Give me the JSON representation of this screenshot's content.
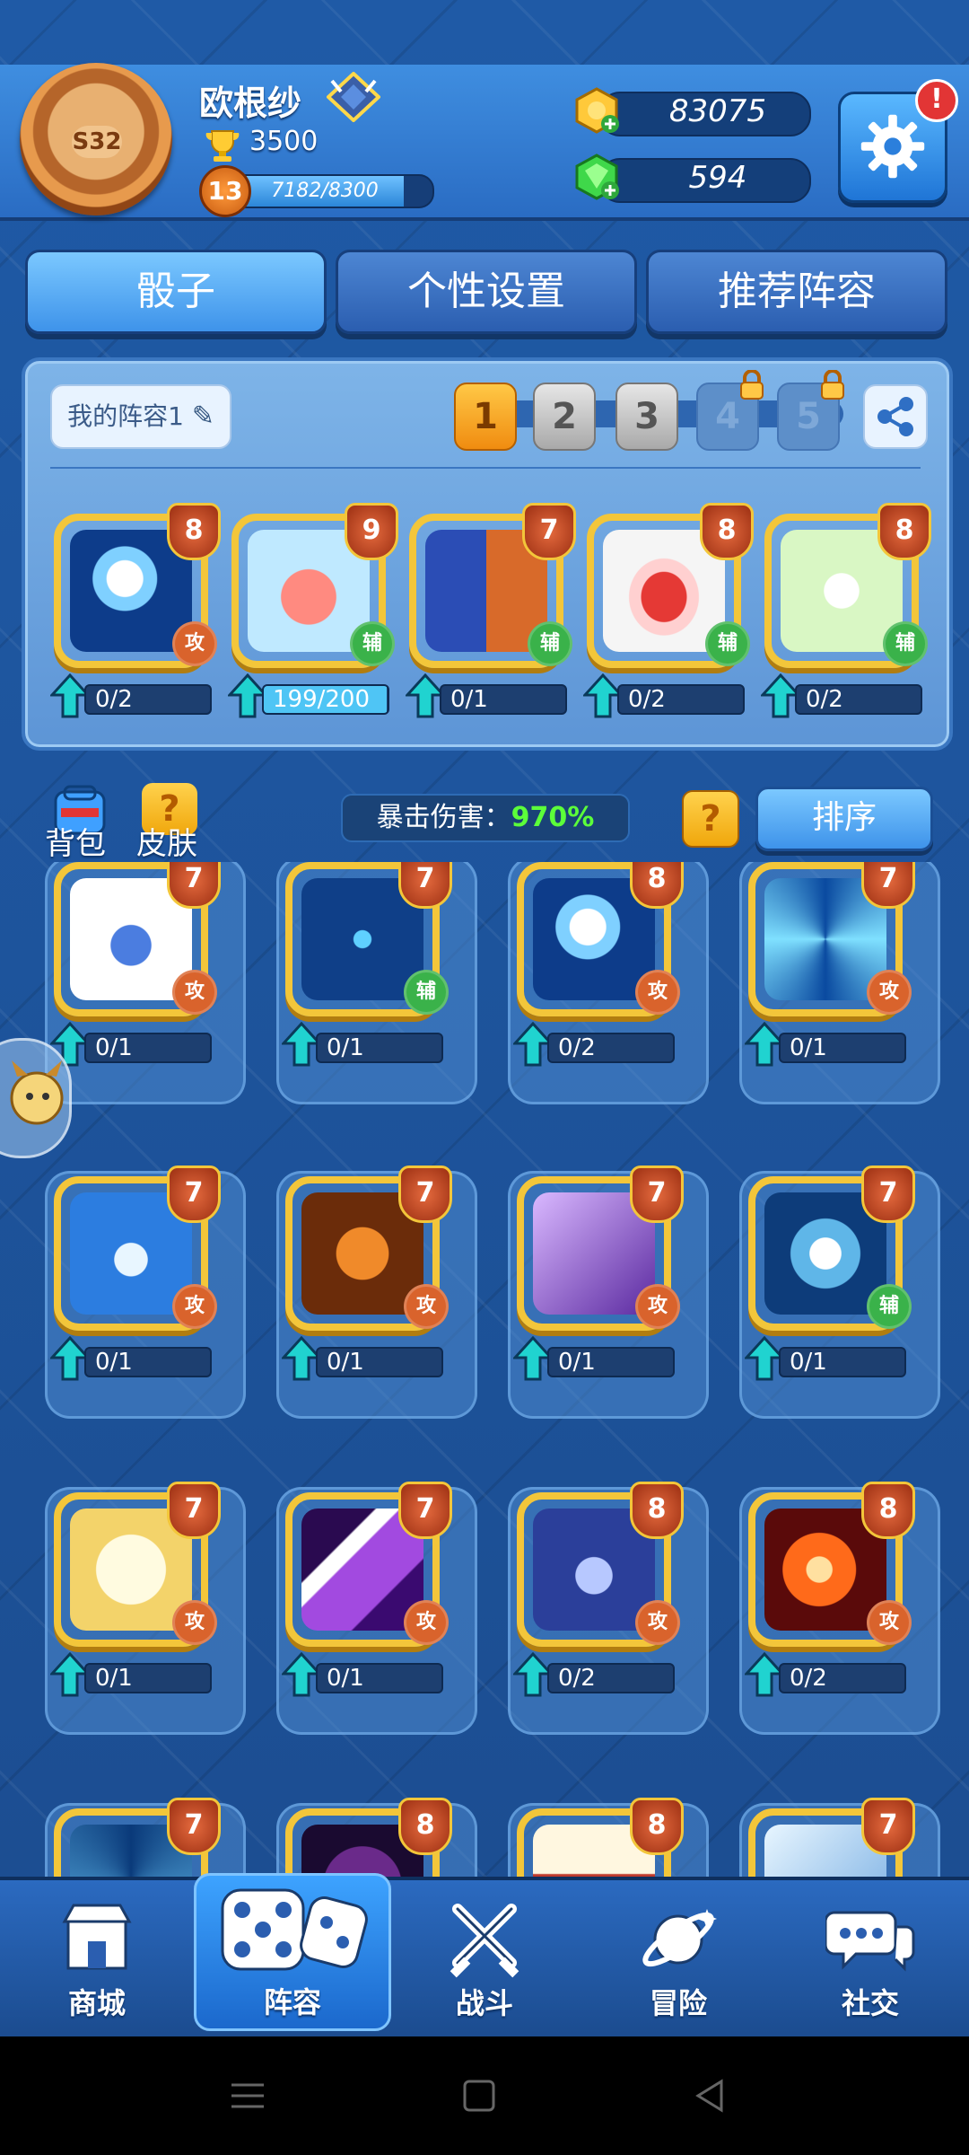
{
  "header": {
    "season_badge": "S32",
    "username": "欧根纱",
    "trophies": "3500",
    "level": "13",
    "xp_text": "7182/8300",
    "xp_fraction": 0.865,
    "gold": "83075",
    "gems": "594",
    "settings_alert": "!"
  },
  "tabs": [
    {
      "label": "骰子"
    },
    {
      "label": "个性设置"
    },
    {
      "label": "推荐阵容"
    }
  ],
  "loadout": {
    "deck_name": "我的阵容1",
    "slots": [
      "1",
      "2",
      "3",
      "4",
      "5"
    ],
    "dice": [
      {
        "level": "8",
        "type": "攻",
        "progress": "0/2",
        "fraction": 0.0,
        "icon": "lightning-figure-icon"
      },
      {
        "level": "9",
        "type": "辅",
        "progress": "199/200",
        "fraction": 0.995,
        "icon": "piggy-bank-icon"
      },
      {
        "level": "7",
        "type": "辅",
        "progress": "0/1",
        "fraction": 0.0,
        "icon": "mirror-figure-icon"
      },
      {
        "level": "8",
        "type": "辅",
        "progress": "0/2",
        "fraction": 0.0,
        "icon": "red-hat-icon"
      },
      {
        "level": "8",
        "type": "辅",
        "progress": "0/2",
        "fraction": 0.0,
        "icon": "green-sparkle-icon"
      }
    ]
  },
  "collection": {
    "bag_label": "背包",
    "skin_label": "皮肤",
    "crit_label": "暴击伤害：",
    "crit_value": "970%",
    "sort_label": "排序",
    "help": "?",
    "dice": [
      {
        "level": "7",
        "type": "攻",
        "progress": "0/1",
        "icon": "robot-face-icon"
      },
      {
        "level": "7",
        "type": "辅",
        "progress": "0/1",
        "icon": "scales-icon"
      },
      {
        "level": "8",
        "type": "攻",
        "progress": "0/2",
        "icon": "lightning-figure-icon"
      },
      {
        "level": "7",
        "type": "攻",
        "progress": "0/1",
        "icon": "swirl-icon"
      },
      {
        "level": "7",
        "type": "攻",
        "progress": "0/1",
        "icon": "water-wave-icon"
      },
      {
        "level": "7",
        "type": "攻",
        "progress": "0/1",
        "icon": "tiger-icon"
      },
      {
        "level": "7",
        "type": "攻",
        "progress": "0/1",
        "icon": "archer-icon"
      },
      {
        "level": "7",
        "type": "辅",
        "progress": "0/1",
        "icon": "dandelion-icon"
      },
      {
        "level": "7",
        "type": "攻",
        "progress": "0/1",
        "icon": "holy-cross-icon"
      },
      {
        "level": "7",
        "type": "攻",
        "progress": "0/1",
        "icon": "purple-beam-icon"
      },
      {
        "level": "8",
        "type": "攻",
        "progress": "0/2",
        "icon": "lotus-icon"
      },
      {
        "level": "8",
        "type": "攻",
        "progress": "0/2",
        "icon": "fire-orb-icon"
      },
      {
        "level": "7",
        "type": "",
        "progress": "",
        "icon": "ice-spiral-icon"
      },
      {
        "level": "8",
        "type": "",
        "progress": "",
        "icon": "galaxy-icon"
      },
      {
        "level": "8",
        "type": "",
        "progress": "",
        "icon": "banner-icon"
      },
      {
        "level": "7",
        "type": "",
        "progress": "",
        "icon": "frost-icon"
      }
    ]
  },
  "bottom_nav": [
    {
      "label": "商城",
      "icon": "shop-icon"
    },
    {
      "label": "阵容",
      "icon": "dice-icon"
    },
    {
      "label": "战斗",
      "icon": "crossed-swords-icon"
    },
    {
      "label": "冒险",
      "icon": "planet-icon"
    },
    {
      "label": "社交",
      "icon": "chat-icon"
    }
  ],
  "colors": {
    "background": "#1d4f95",
    "accent_gold": "#f3c63a",
    "attack": "#d9632c",
    "support": "#3ab24a",
    "crit_value": "#5cff3a"
  }
}
